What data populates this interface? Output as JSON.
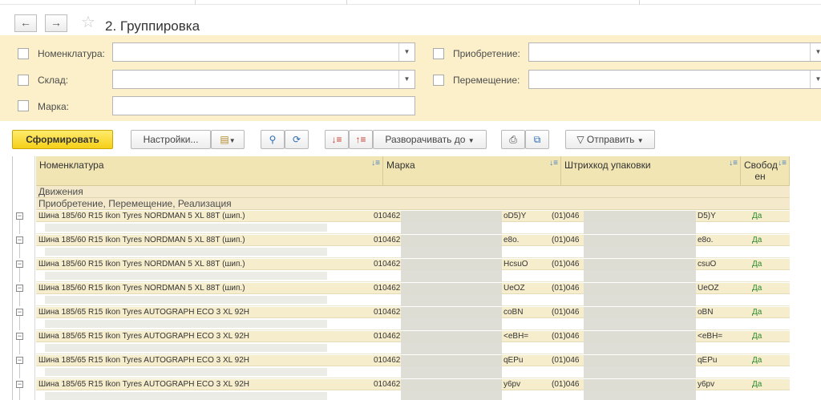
{
  "nav": {
    "back": "←",
    "forward": "→"
  },
  "title": "2. Группировка",
  "filters": {
    "nomenclature": {
      "label": "Номенклатура:",
      "value": ""
    },
    "warehouse": {
      "label": "Склад:",
      "value": ""
    },
    "brand": {
      "label": "Марка:",
      "value": ""
    },
    "acquisition": {
      "label": "Приобретение:",
      "value": ""
    },
    "transfer": {
      "label": "Перемещение:",
      "value": ""
    }
  },
  "toolbar": {
    "generate": "Сформировать",
    "settings": "Настройки...",
    "expand_to": "Разворачивать до",
    "send": "Отправить"
  },
  "table": {
    "columns": [
      "Номенклатура",
      "Марка",
      "Штрихкод упаковки",
      "Свобод ен"
    ],
    "group1": "Движения",
    "group2": "Приобретение, Перемещение, Реализация",
    "rows": [
      {
        "name": "Шина 185/60 R15 Ikon Tyres NORDMAN 5 XL 88T (шип.)",
        "mark_start": "010462",
        "mark_end": "oD5)Y",
        "barcode_start": "(01)046",
        "barcode_end": "D5)Y",
        "free": "Да"
      },
      {
        "name": "Шина 185/60 R15 Ikon Tyres NORDMAN 5 XL 88T (шип.)",
        "mark_start": "010462",
        "mark_end": "e8o.",
        "barcode_start": "(01)046",
        "barcode_end": "e8o.",
        "free": "Да"
      },
      {
        "name": "Шина 185/60 R15 Ikon Tyres NORDMAN 5 XL 88T (шип.)",
        "mark_start": "010462",
        "mark_end": "HcsuO",
        "barcode_start": "(01)046",
        "barcode_end": "csuO",
        "free": "Да"
      },
      {
        "name": "Шина 185/60 R15 Ikon Tyres NORDMAN 5 XL 88T (шип.)",
        "mark_start": "010462",
        "mark_end": "UeOZ",
        "barcode_start": "(01)046",
        "barcode_end": "UeOZ",
        "free": "Да"
      },
      {
        "name": "Шина 185/65 R15 Ikon Tyres AUTOGRAPH ECO 3 XL 92H",
        "mark_start": "010462",
        "mark_end": "coBN",
        "barcode_start": "(01)046",
        "barcode_end": "oBN",
        "free": "Да"
      },
      {
        "name": "Шина 185/65 R15 Ikon Tyres AUTOGRAPH ECO 3 XL 92H",
        "mark_start": "010462",
        "mark_end": "<eBH=",
        "barcode_start": "(01)046",
        "barcode_end": "<eBH=",
        "free": "Да"
      },
      {
        "name": "Шина 185/65 R15 Ikon Tyres AUTOGRAPH ECO 3 XL 92H",
        "mark_start": "010462",
        "mark_end": "qEPu",
        "barcode_start": "(01)046",
        "barcode_end": "qEPu",
        "free": "Да"
      },
      {
        "name": "Шина 185/65 R15 Ikon Tyres AUTOGRAPH ECO 3 XL 92H",
        "mark_start": "010462",
        "mark_end": "y6pv",
        "barcode_start": "(01)046",
        "barcode_end": "y6pv",
        "free": "Да"
      }
    ]
  }
}
